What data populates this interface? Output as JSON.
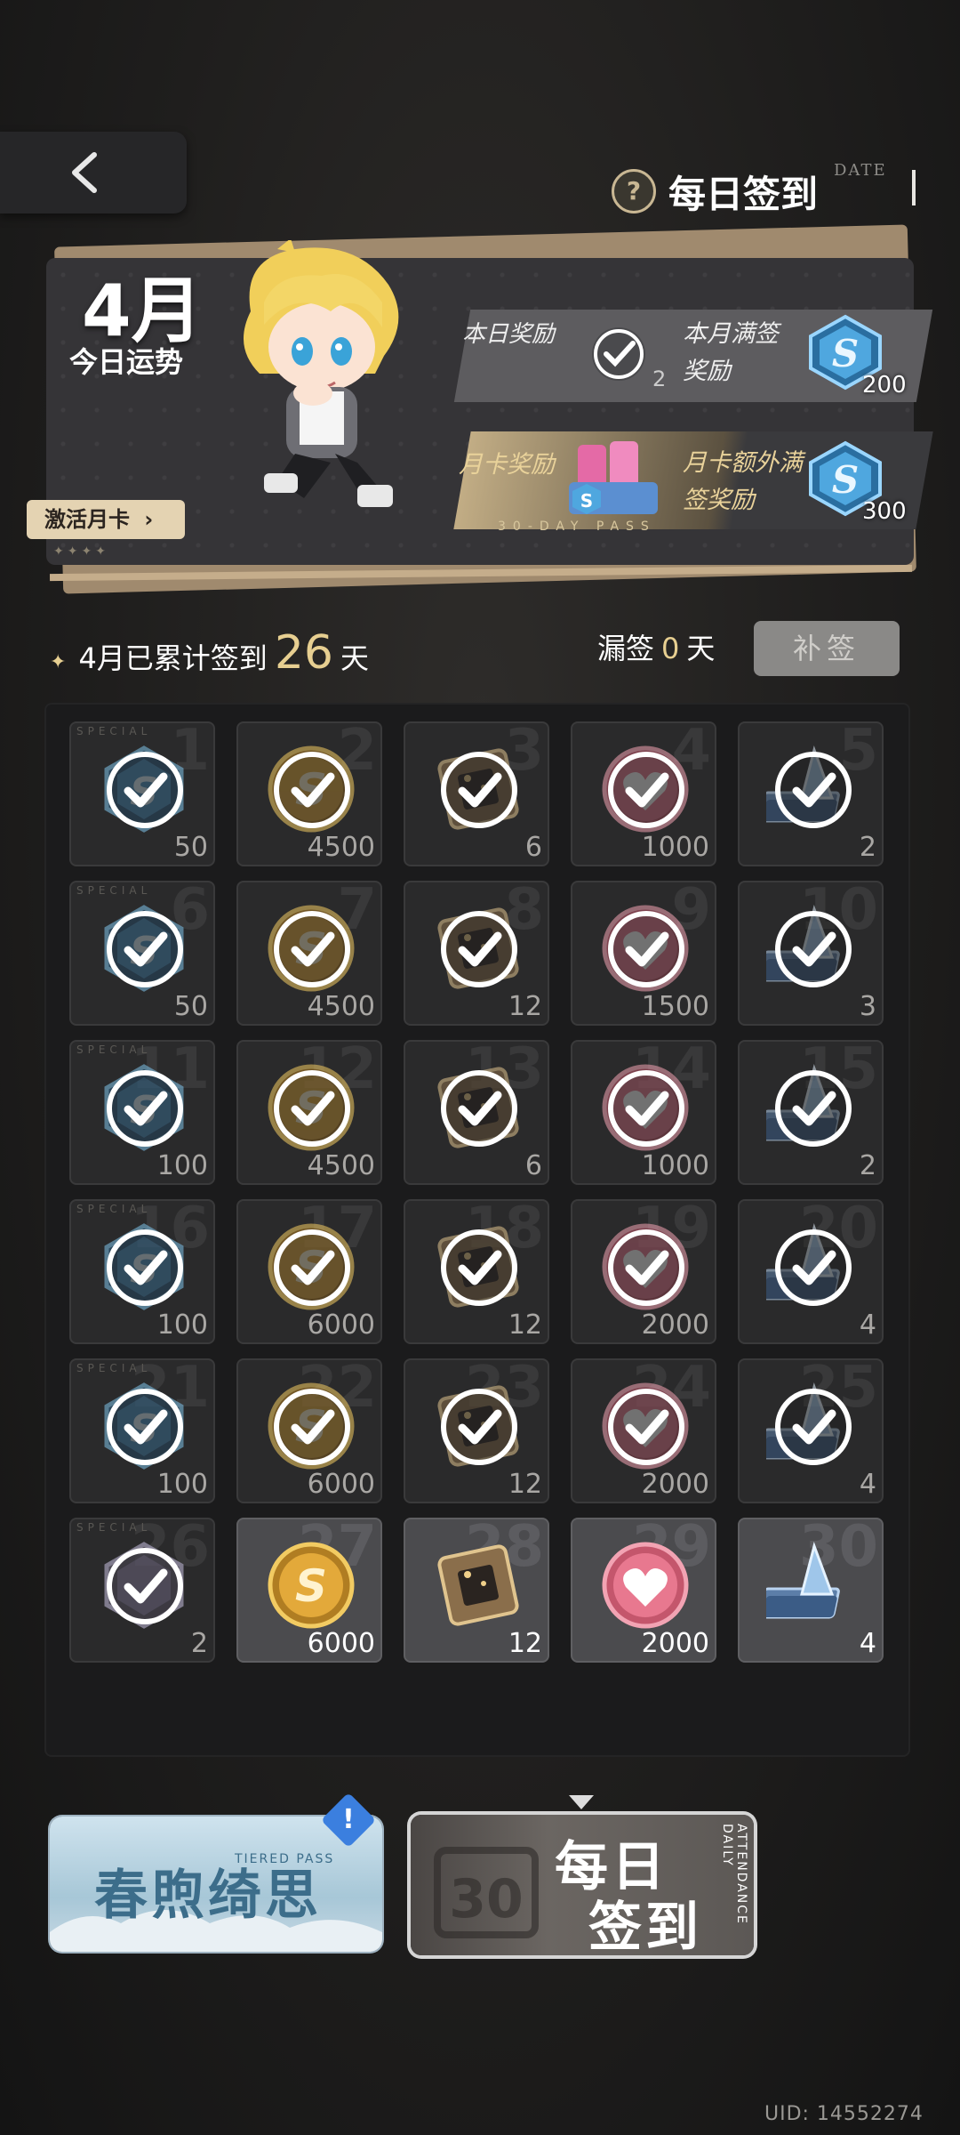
{
  "header": {
    "title": "每日签到",
    "title_tag": "DATE",
    "back_icon": "chevron-left-icon",
    "help_glyph": "?"
  },
  "banner": {
    "month": "4月",
    "fortune_label": "今日运势",
    "activate_button": "激活月卡",
    "stars": "✦✦✦✦",
    "today_reward_label": "本日奖励",
    "today_reward_count": "2",
    "monthly_full_label": "本月满签奖励",
    "monthly_full_count": "200",
    "card_reward_label": "月卡奖励",
    "card_extra_label": "月卡额外满签奖励",
    "card_extra_count": "300",
    "pass_text": "30-DAY PASS"
  },
  "summary": {
    "prefix": "4月已累计签到",
    "days": "26",
    "suffix": "天",
    "missed_label": "漏签",
    "missed_days": "0",
    "missed_suffix": "天",
    "makeup_button": "补签"
  },
  "special_tag": "SPECIAL",
  "calendar": [
    {
      "day": "1",
      "item": "blue-gem",
      "qty": "50",
      "claimed": true,
      "special": true
    },
    {
      "day": "2",
      "item": "gold-coin",
      "qty": "4500",
      "claimed": true
    },
    {
      "day": "3",
      "item": "chip",
      "qty": "6",
      "claimed": true
    },
    {
      "day": "4",
      "item": "heart",
      "qty": "1000",
      "claimed": true
    },
    {
      "day": "5",
      "item": "ticket",
      "qty": "2",
      "claimed": true
    },
    {
      "day": "6",
      "item": "blue-gem",
      "qty": "50",
      "claimed": true,
      "special": true
    },
    {
      "day": "7",
      "item": "gold-coin",
      "qty": "4500",
      "claimed": true
    },
    {
      "day": "8",
      "item": "chip",
      "qty": "12",
      "claimed": true
    },
    {
      "day": "9",
      "item": "heart",
      "qty": "1500",
      "claimed": true
    },
    {
      "day": "10",
      "item": "ticket",
      "qty": "3",
      "claimed": true
    },
    {
      "day": "11",
      "item": "blue-gem",
      "qty": "100",
      "claimed": true,
      "special": true
    },
    {
      "day": "12",
      "item": "gold-coin",
      "qty": "4500",
      "claimed": true
    },
    {
      "day": "13",
      "item": "chip",
      "qty": "6",
      "claimed": true
    },
    {
      "day": "14",
      "item": "heart",
      "qty": "1000",
      "claimed": true
    },
    {
      "day": "15",
      "item": "ticket",
      "qty": "2",
      "claimed": true
    },
    {
      "day": "16",
      "item": "blue-gem",
      "qty": "100",
      "claimed": true,
      "special": true
    },
    {
      "day": "17",
      "item": "gold-coin",
      "qty": "6000",
      "claimed": true
    },
    {
      "day": "18",
      "item": "chip",
      "qty": "12",
      "claimed": true
    },
    {
      "day": "19",
      "item": "heart",
      "qty": "2000",
      "claimed": true
    },
    {
      "day": "20",
      "item": "ticket",
      "qty": "4",
      "claimed": true
    },
    {
      "day": "21",
      "item": "blue-gem",
      "qty": "100",
      "claimed": true,
      "special": true
    },
    {
      "day": "22",
      "item": "gold-coin",
      "qty": "6000",
      "claimed": true
    },
    {
      "day": "23",
      "item": "chip",
      "qty": "12",
      "claimed": true
    },
    {
      "day": "24",
      "item": "heart",
      "qty": "2000",
      "claimed": true
    },
    {
      "day": "25",
      "item": "ticket",
      "qty": "4",
      "claimed": true
    },
    {
      "day": "26",
      "item": "purple-gem",
      "qty": "2",
      "claimed": true,
      "special": true
    },
    {
      "day": "27",
      "item": "gold-coin",
      "qty": "6000",
      "claimed": false
    },
    {
      "day": "28",
      "item": "chip",
      "qty": "12",
      "claimed": false
    },
    {
      "day": "29",
      "item": "heart",
      "qty": "2000",
      "claimed": false
    },
    {
      "day": "30",
      "item": "ticket",
      "qty": "4",
      "claimed": false
    }
  ],
  "tabs": {
    "spring_title": "春煦绮思",
    "spring_sub": "TIERED PASS",
    "alert_glyph": "!",
    "daily_line1": "每日",
    "daily_line2": "签到",
    "daily_vertical": "ATTENDANCE DAILY"
  },
  "uid": "UID: 14552274",
  "colors": {
    "accent_gold": "#e7cf91",
    "panel_bg": "#1b1b1c",
    "cell_bg": "#2a2a2b",
    "unclaimed_bg": "#4b4b4e"
  }
}
